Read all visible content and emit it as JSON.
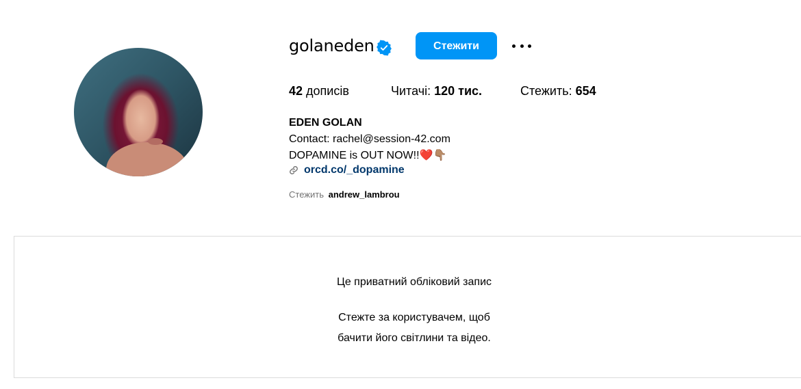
{
  "profile": {
    "username": "golaneden",
    "verified": true,
    "follow_label": "Стежити",
    "more_icon": "more-options-icon",
    "accent_color": "#0095f6",
    "link_color": "#00376b"
  },
  "stats": {
    "posts_count": "42",
    "posts_label": "дописів",
    "followers_label": "Читачі:",
    "followers_count": "120 тис.",
    "following_label": "Стежить:",
    "following_count": "654"
  },
  "bio": {
    "name": "EDEN GOLAN",
    "line1": "Contact: rachel@session-42.com",
    "line2": "DOPAMINE is OUT NOW!!",
    "emoji_heart": "❤️",
    "emoji_hand": "👇🏽",
    "link": "orcd.co/_dopamine"
  },
  "followed_by": {
    "label": "Стежить",
    "user": "andrew_lambrou"
  },
  "private": {
    "title": "Це приватний обліковий запис",
    "subtitle_line1": "Стежте за користувачем, щоб",
    "subtitle_line2": "бачити його світлини та відео."
  }
}
